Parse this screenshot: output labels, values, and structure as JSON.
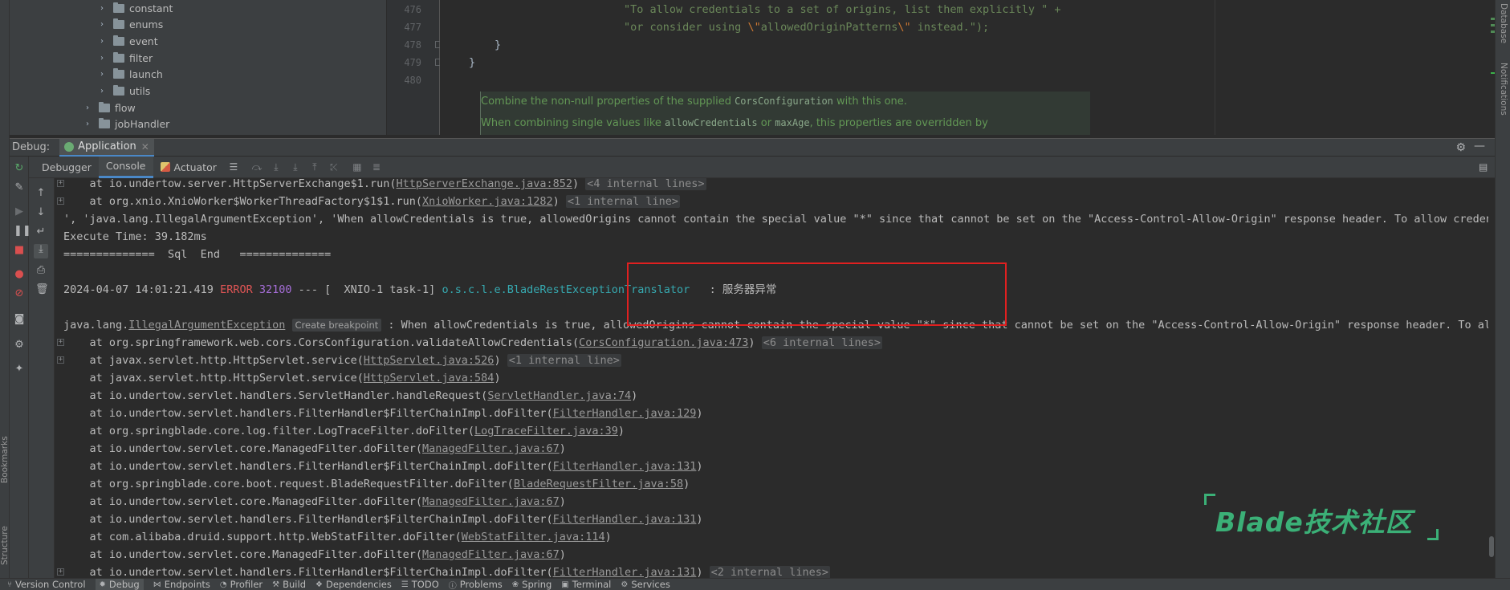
{
  "project_tree": [
    {
      "label": "constant",
      "level": 2
    },
    {
      "label": "enums",
      "level": 2
    },
    {
      "label": "event",
      "level": 2
    },
    {
      "label": "filter",
      "level": 2
    },
    {
      "label": "launch",
      "level": 2
    },
    {
      "label": "utils",
      "level": 2
    },
    {
      "label": "flow",
      "level": 1
    },
    {
      "label": "jobHandler",
      "level": 1
    }
  ],
  "editor": {
    "line_numbers": [
      "476",
      "477",
      "478",
      "479",
      "480"
    ],
    "line_476": "\"To allow credentials to a set of origins, list them explicitly \" +",
    "line_477_pre": "\"or consider using ",
    "line_477_esc1": "\\\"",
    "line_477_mid": "allowedOriginPatterns",
    "line_477_esc2": "\\\"",
    "line_477_post": " instead.\");",
    "line_478": "}",
    "line_479": "}",
    "doc_1_pre": "Combine the non-null properties of the supplied ",
    "doc_1_code": "CorsConfiguration",
    "doc_1_post": " with this one.",
    "doc_2_pre": "When combining single values like ",
    "doc_2_code1": "allowCredentials",
    "doc_2_mid": " or ",
    "doc_2_code2": "maxAge",
    "doc_2_post": ", this properties are overridden by"
  },
  "debug": {
    "label": "Debug:",
    "app_tab": "Application",
    "tabs": [
      "Debugger",
      "Console",
      "Actuator"
    ],
    "active_tab": "Console"
  },
  "console": {
    "l1_pre": "    at io.undertow.server.HttpServerExchange$1.run(",
    "l1_link": "HttpServerExchange.java:852",
    "l1_post": ")",
    "l1_hint": "<4 internal lines>",
    "l2_pre": "    at org.xnio.XnioWorker$WorkerThreadFactory$1$1.run(",
    "l2_link": "XnioWorker.java:1282",
    "l2_post": ")",
    "l2_hint": "<1 internal line>",
    "l3": "', 'java.lang.IllegalArgumentException', 'When allowCredentials is true, allowedOrigins cannot contain the special value \"*\" since that cannot be set on the \"Access-Control-Allow-Origin\" response header. To allow credentials",
    "l4": "Execute Time: 39.182ms",
    "l5": "==============  Sql  End   ==============",
    "l6_date": "2024-04-07 14:01:21.419 ",
    "l6_level": "ERROR",
    "l6_pid": " 32100",
    "l6_mid": " --- [  XNIO-1 task-1] ",
    "l6_class": "o.s.c.l.e.BladeRestExceptionTranslator",
    "l6_msg": "   : 服务器异常",
    "l7_pre": "java.lang.",
    "l7_exc": "IllegalArgumentException",
    "l7_bp": "Create breakpoint",
    "l7_post": " : When allowCredentials is true, allowedOrigins cannot contain the special value \"*\" since that cannot be set on the \"Access-Control-Allow-Origin\" response header. To allow cre",
    "frames": [
      {
        "pre": "    at org.springframework.web.cors.CorsConfiguration.validateAllowCredentials(",
        "link": "CorsConfiguration.java:473",
        "post": ")",
        "hint": "<6 internal lines>",
        "plus": true
      },
      {
        "pre": "    at javax.servlet.http.HttpServlet.service(",
        "link": "HttpServlet.java:526",
        "post": ")",
        "hint": "<1 internal line>",
        "plus": true
      },
      {
        "pre": "    at javax.servlet.http.HttpServlet.service(",
        "link": "HttpServlet.java:584",
        "post": ")",
        "hint": "",
        "plus": false
      },
      {
        "pre": "    at io.undertow.servlet.handlers.ServletHandler.handleRequest(",
        "link": "ServletHandler.java:74",
        "post": ")",
        "hint": "",
        "plus": false
      },
      {
        "pre": "    at io.undertow.servlet.handlers.FilterHandler$FilterChainImpl.doFilter(",
        "link": "FilterHandler.java:129",
        "post": ")",
        "hint": "",
        "plus": false
      },
      {
        "pre": "    at org.springblade.core.log.filter.LogTraceFilter.doFilter(",
        "link": "LogTraceFilter.java:39",
        "post": ")",
        "hint": "",
        "plus": false
      },
      {
        "pre": "    at io.undertow.servlet.core.ManagedFilter.doFilter(",
        "link": "ManagedFilter.java:67",
        "post": ")",
        "hint": "",
        "plus": false
      },
      {
        "pre": "    at io.undertow.servlet.handlers.FilterHandler$FilterChainImpl.doFilter(",
        "link": "FilterHandler.java:131",
        "post": ")",
        "hint": "",
        "plus": false
      },
      {
        "pre": "    at org.springblade.core.boot.request.BladeRequestFilter.doFilter(",
        "link": "BladeRequestFilter.java:58",
        "post": ")",
        "hint": "",
        "plus": false
      },
      {
        "pre": "    at io.undertow.servlet.core.ManagedFilter.doFilter(",
        "link": "ManagedFilter.java:67",
        "post": ")",
        "hint": "",
        "plus": false
      },
      {
        "pre": "    at io.undertow.servlet.handlers.FilterHandler$FilterChainImpl.doFilter(",
        "link": "FilterHandler.java:131",
        "post": ")",
        "hint": "",
        "plus": false
      },
      {
        "pre": "    at com.alibaba.druid.support.http.WebStatFilter.doFilter(",
        "link": "WebStatFilter.java:114",
        "post": ")",
        "hint": "",
        "plus": false
      },
      {
        "pre": "    at io.undertow.servlet.core.ManagedFilter.doFilter(",
        "link": "ManagedFilter.java:67",
        "post": ")",
        "hint": "",
        "plus": false
      },
      {
        "pre": "    at io.undertow.servlet.handlers.FilterHandler$FilterChainImpl.doFilter(",
        "link": "FilterHandler.java:131",
        "post": ")",
        "hint": "<2 internal lines>",
        "plus": true
      }
    ]
  },
  "watermark": "Blade技术社区",
  "side_labels": {
    "bookmarks": "Bookmarks",
    "structure": "Structure",
    "database": "Database",
    "notifications": "Notifications"
  },
  "statusbar": [
    {
      "label": "Version Control",
      "icon": "branch-icon"
    },
    {
      "label": "Debug",
      "icon": "bug-icon",
      "active": true
    },
    {
      "label": "Endpoints",
      "icon": "endpoints-icon"
    },
    {
      "label": "Profiler",
      "icon": "profiler-icon"
    },
    {
      "label": "Build",
      "icon": "hammer-icon"
    },
    {
      "label": "Dependencies",
      "icon": "dependencies-icon"
    },
    {
      "label": "TODO",
      "icon": "list-icon"
    },
    {
      "label": "Problems",
      "icon": "info-icon"
    },
    {
      "label": "Spring",
      "icon": "spring-icon"
    },
    {
      "label": "Terminal",
      "icon": "terminal-icon"
    },
    {
      "label": "Services",
      "icon": "services-icon"
    }
  ],
  "colors": {
    "accent": "#4a88c7",
    "error": "#e05555",
    "highlight_box": "#e02020",
    "watermark": "#3bb077"
  }
}
